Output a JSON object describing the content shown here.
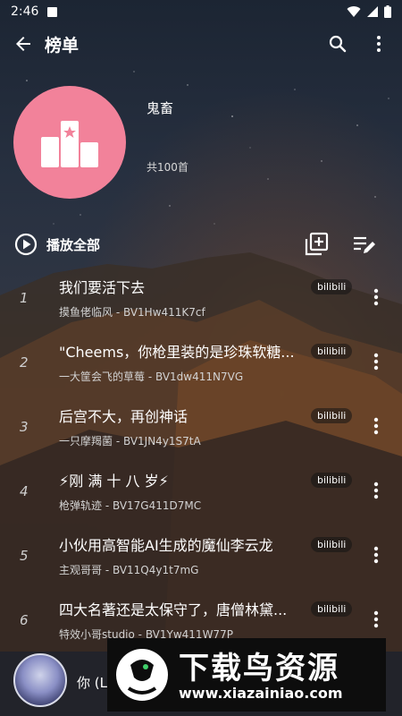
{
  "status_bar": {
    "time": "2:46"
  },
  "app_bar": {
    "title": "榜单"
  },
  "playlist": {
    "name": "鬼畜",
    "count": "共100首",
    "play_all_label": "播放全部",
    "cover_color": "#f2829a"
  },
  "songs": [
    {
      "index": "1",
      "title": "我们要活下去",
      "subtitle": "摸鱼佬临风 - BV1Hw411K7cf",
      "source": "bilibili"
    },
    {
      "index": "2",
      "title": "\"Cheems，你枪里装的是珍珠软糖...",
      "subtitle": "一大筐会飞的草莓 - BV1dw411N7VG",
      "source": "bilibili"
    },
    {
      "index": "3",
      "title": "后宫不大，再创神话",
      "subtitle": "一只摩羯菌 - BV1JN4y1S7tA",
      "source": "bilibili"
    },
    {
      "index": "4",
      "title": "⚡刚 满 十 八 岁⚡",
      "subtitle": "枪弹轨迹 - BV17G411D7MC",
      "source": "bilibili"
    },
    {
      "index": "5",
      "title": "小伙用高智能AI生成的魔仙李云龙",
      "subtitle": "主观哥哥 - BV11Q4y1t7mG",
      "source": "bilibili"
    },
    {
      "index": "6",
      "title": "四大名著还是太保守了，唐僧林黛...",
      "subtitle": "特效小哥studio - BV1Yw411W77P",
      "source": "bilibili"
    }
  ],
  "now_playing": {
    "title": "你 (L"
  },
  "watermark": {
    "title": "下载鸟资源",
    "url": "www.xiazainiao.com"
  }
}
